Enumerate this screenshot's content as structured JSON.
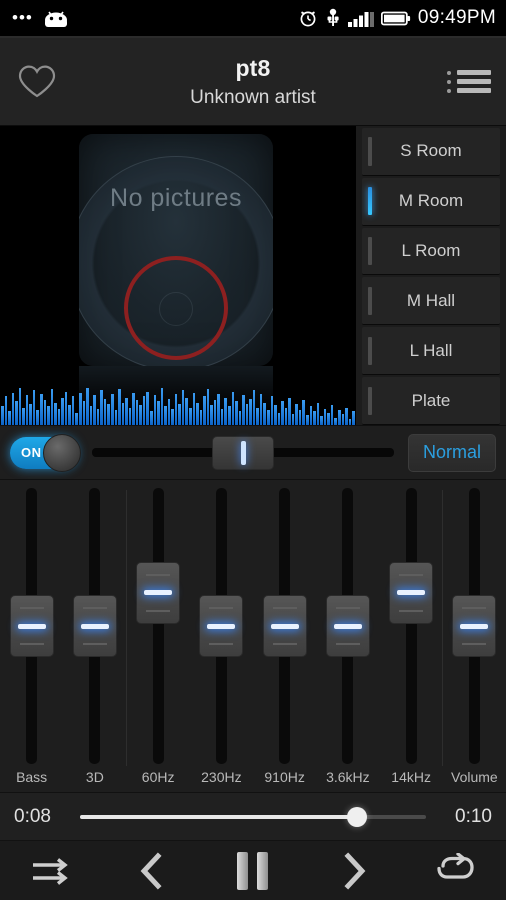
{
  "statusbar": {
    "time": "09:49PM",
    "dots": "•••",
    "icons": [
      "android-robot-icon",
      "alarm-clock-icon",
      "usb-icon",
      "signal-bars-icon",
      "battery-icon"
    ]
  },
  "header": {
    "title": "pt8",
    "artist": "Unknown artist",
    "favorite_icon": "heart-icon",
    "playlist_icon": "list-menu-icon"
  },
  "album_art": {
    "placeholder_text": "No pictures"
  },
  "reverb": {
    "items": [
      {
        "label": "S Room",
        "selected": false
      },
      {
        "label": "M Room",
        "selected": true
      },
      {
        "label": "L Room",
        "selected": false
      },
      {
        "label": "M Hall",
        "selected": false
      },
      {
        "label": "L Hall",
        "selected": false
      },
      {
        "label": "Plate",
        "selected": false
      }
    ]
  },
  "controls": {
    "toggle_label": "ON",
    "toggle_on": true,
    "balance_percent": 50,
    "preset_label": "Normal"
  },
  "equalizer": {
    "bands": [
      {
        "label": "Bass",
        "value_percent": 50
      },
      {
        "label": "3D",
        "value_percent": 50
      },
      {
        "label": "60Hz",
        "value_percent": 62
      },
      {
        "label": "230Hz",
        "value_percent": 50
      },
      {
        "label": "910Hz",
        "value_percent": 50
      },
      {
        "label": "3.6kHz",
        "value_percent": 50
      },
      {
        "label": "14kHz",
        "value_percent": 62
      },
      {
        "label": "Volume",
        "value_percent": 50
      }
    ]
  },
  "progress": {
    "elapsed": "0:08",
    "total": "0:10",
    "percent": 80
  },
  "transport": {
    "buttons": [
      {
        "name": "shuffle-icon",
        "label": "shuffle"
      },
      {
        "name": "previous-icon",
        "label": "previous"
      },
      {
        "name": "pause-icon",
        "label": "pause"
      },
      {
        "name": "next-icon",
        "label": "next"
      },
      {
        "name": "repeat-icon",
        "label": "repeat"
      }
    ]
  },
  "colors": {
    "accent_blue": "#2b9fe0",
    "toggle_blue": "#1fa8e8",
    "visualizer_blue": "#3a9bf0",
    "vinyl_red": "#8d2020",
    "background": "#1e1e1e"
  },
  "visualizer": {
    "bars": [
      30,
      46,
      22,
      52,
      38,
      60,
      28,
      48,
      34,
      56,
      24,
      50,
      40,
      30,
      58,
      36,
      26,
      44,
      54,
      32,
      46,
      20,
      52,
      38,
      60,
      30,
      48,
      26,
      56,
      42,
      34,
      50,
      24,
      58,
      36,
      44,
      28,
      52,
      40,
      32,
      46,
      54,
      22,
      48,
      38,
      60,
      30,
      42,
      26,
      50,
      34,
      56,
      44,
      28,
      52,
      36,
      24,
      46,
      58,
      32,
      40,
      50,
      26,
      44,
      30,
      54,
      38,
      22,
      48,
      34,
      42,
      56,
      28,
      50,
      36,
      24,
      46,
      32,
      20,
      38,
      28,
      44,
      18,
      34,
      24,
      40,
      16,
      30,
      22,
      36,
      14,
      26,
      20,
      32,
      12,
      24,
      18,
      28,
      10,
      22
    ]
  }
}
